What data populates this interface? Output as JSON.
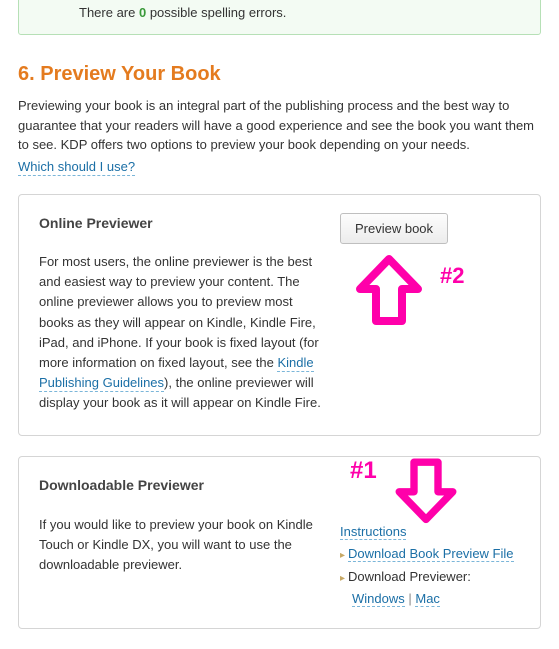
{
  "spellcheck": {
    "prefix": "There are ",
    "count": "0",
    "suffix": " possible spelling errors."
  },
  "section": {
    "title": "6. Preview Your Book",
    "intro": "Previewing your book is an integral part of the publishing process and the best way to guarantee that your readers will have a good experience and see the book you want them to see. KDP offers two options to preview your book depending on your needs.",
    "which_link": "Which should I use?"
  },
  "online": {
    "heading": "Online Previewer",
    "text_a": "For most users, the online previewer is the best and easiest way to preview your content. The online previewer allows you to preview most books as they will appear on Kindle, Kindle Fire, iPad, and iPhone. If your book is fixed layout (for more information on fixed layout, see the ",
    "guidelines_link": "Kindle Publishing Guidelines",
    "text_b": "), the online previewer will display your book as it will appear on Kindle Fire.",
    "button": "Preview book",
    "marker": "#2"
  },
  "downloadable": {
    "heading": "Downloadable Previewer",
    "text": "If you would like to preview your book on Kindle Touch or Kindle DX, you will want to use the downloadable previewer.",
    "marker": "#1",
    "instructions": "Instructions",
    "download_file": "Download Book Preview File",
    "download_label": "Download Previewer:",
    "windows": "Windows",
    "sep": " | ",
    "mac": "Mac"
  }
}
